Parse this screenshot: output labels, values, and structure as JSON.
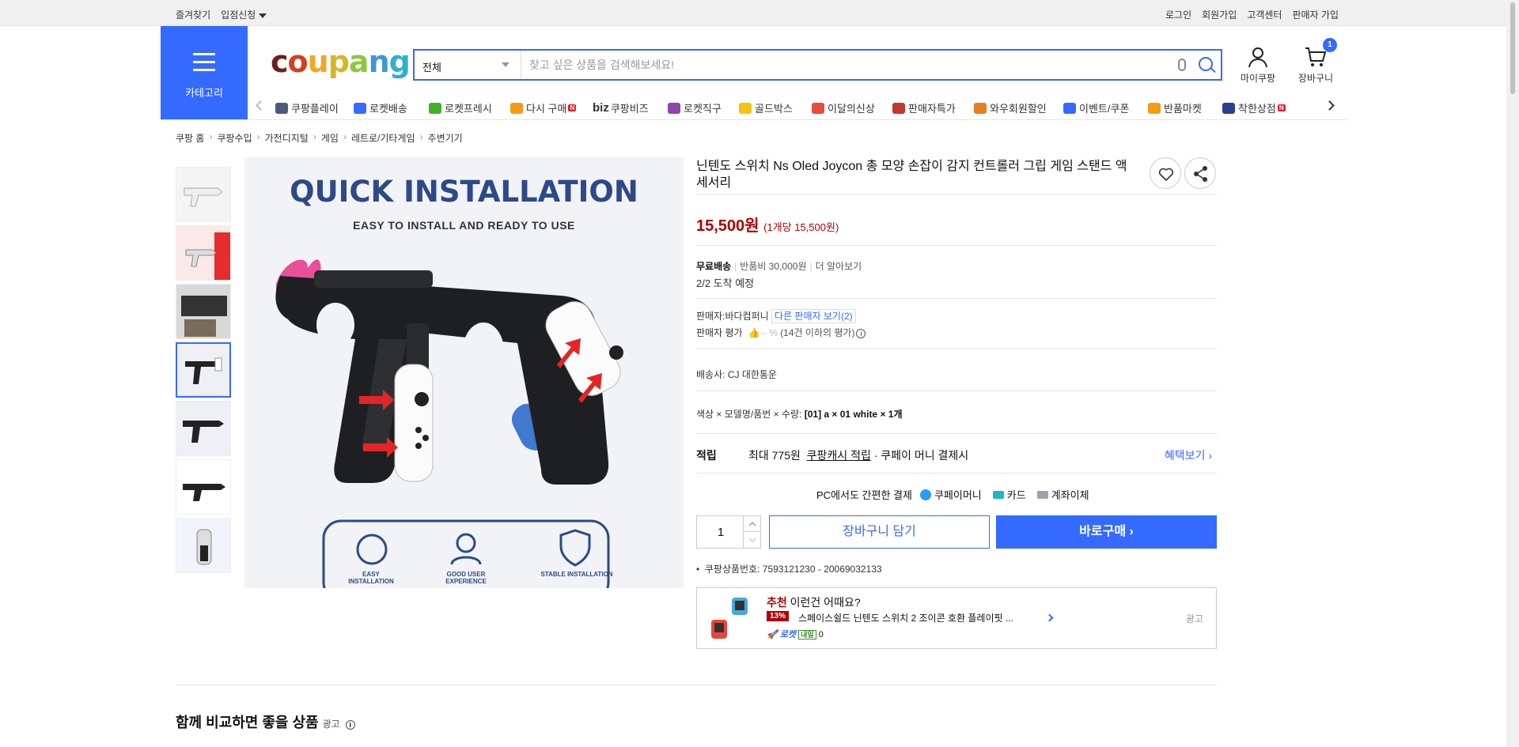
{
  "topbar": {
    "left": [
      "즐겨찾기",
      "입점신청"
    ],
    "right": [
      "로그인",
      "회원가입",
      "고객센터",
      "판매자 가입"
    ]
  },
  "category_label": "카테고리",
  "logo": {
    "letters": [
      "c",
      "o",
      "u",
      "p",
      "a",
      "n",
      "g"
    ],
    "colors": [
      "#6d1f1f",
      "#d43f1f",
      "#f5a623",
      "#d8b426",
      "#8ac93c",
      "#3d9ad1",
      "#2eb0cc"
    ]
  },
  "search": {
    "category": "전체",
    "placeholder": "찾고 싶은 상품을 검색해보세요!"
  },
  "header": {
    "mypage": "마이쿠팡",
    "cart": "장바구니",
    "cart_count": "1"
  },
  "nav": [
    {
      "label": "쿠팡플레이",
      "icon": "play-icon",
      "color": "#4b5a78"
    },
    {
      "label": "로켓배송",
      "icon": "rocket-icon",
      "color": "#346aff"
    },
    {
      "label": "로켓프레시",
      "icon": "rocket-fresh-icon",
      "color": "#43b02a"
    },
    {
      "label": "다시 구매",
      "icon": "repurchase-icon",
      "color": "#f39c12",
      "new": "N"
    },
    {
      "label": "쿠팡비즈",
      "icon": "biz-icon",
      "color": "#333",
      "prefix": "biz"
    },
    {
      "label": "로켓직구",
      "icon": "global-icon",
      "color": "#8e44ad"
    },
    {
      "label": "골드박스",
      "icon": "goldbox-icon",
      "color": "#f1c40f"
    },
    {
      "label": "이달의신상",
      "icon": "new-product-icon",
      "color": "#e74c3c"
    },
    {
      "label": "판매자특가",
      "icon": "seller-deal-icon",
      "color": "#c0392b"
    },
    {
      "label": "와우회원할인",
      "icon": "wow-icon",
      "color": "#e67e22"
    },
    {
      "label": "이벤트/쿠폰",
      "icon": "coupon-icon",
      "color": "#346aff"
    },
    {
      "label": "반품마켓",
      "icon": "return-market-icon",
      "color": "#f39c12"
    },
    {
      "label": "착한상점",
      "icon": "good-store-icon",
      "color": "#2c3e91",
      "new": "N"
    }
  ],
  "breadcrumb": [
    "쿠팡 홈",
    "쿠팡수입",
    "가전디지털",
    "게임",
    "레트로/기타게임",
    "주변기기"
  ],
  "main_image": {
    "title": "QUICK INSTALLATION",
    "subtitle": "EASY TO INSTALL AND READY TO USE",
    "features": [
      "EASY INSTALLATION",
      "GOOD USER EXPERIENCE",
      "STABLE INSTALLATION"
    ]
  },
  "product": {
    "title": "닌텐도 스위치 Ns Oled Joycon 총 모양 손잡이 감지 컨트롤러 그립 게임 스탠드 액세서리",
    "price": "15,500원",
    "unit_price": "(1개당 15,500원)",
    "shipping": "무료배송",
    "return_fee": "반품비 30,000원",
    "learn_more": "더 알아보기",
    "arrival": "2/2 도착 예정",
    "seller_label": "판매자:",
    "seller": "바다컴퍼니",
    "other_sellers": "다른 판매자 보기(2)",
    "rating_label": "판매자 평가",
    "rating": "-- %",
    "rating_count": "(14건 이하의 평가)",
    "carrier_label": "배송사:",
    "carrier": "CJ 대한통운",
    "option_label": "색상 × 모델명/품번 × 수량:",
    "option_value": "[01] a × 01 white × 1개",
    "reward_label": "적립",
    "reward_prefix": "최대 775원",
    "reward_link": "쿠팡캐시 적립",
    "reward_suffix": "· 쿠페이 머니 결제시",
    "benefit_link": "혜택보기",
    "pay_label": "PC에서도 간편한 결제",
    "pay_methods": [
      "쿠페이머니",
      "카드",
      "계좌이체"
    ],
    "quantity": "1",
    "add_cart": "장바구니 담기",
    "buy_now": "바로구매",
    "product_no": "쿠팡상품번호: 7593121230 - 20069032133"
  },
  "recommend": {
    "label_red": "추천",
    "label": "이런건 어때요?",
    "discount": "13%",
    "name": "스페이스쉴드 닌텐도 스위치 2 조이콘 호환 플레이핏 ...",
    "rocket": "로켓",
    "tomorrow": "내일",
    "reviews": "0",
    "ad": "광고"
  },
  "compare": {
    "title": "함께 비교하면 좋을 상품",
    "ad": "광고"
  }
}
